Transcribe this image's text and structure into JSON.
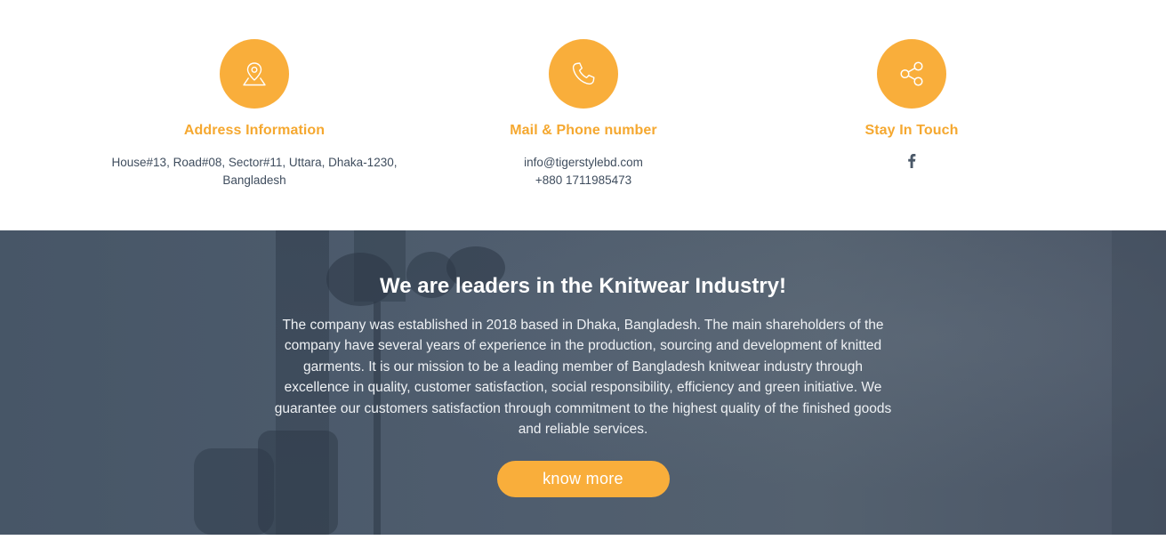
{
  "accent_color": "#f9ae3b",
  "contact": {
    "address": {
      "icon": "map-pin-icon",
      "title": "Address Information",
      "line1": "House#13, Road#08, Sector#11, Uttara, Dhaka-1230,",
      "line2": "Bangladesh"
    },
    "mail_phone": {
      "icon": "phone-icon",
      "title": "Mail & Phone number",
      "email": "info@tigerstylebd.com",
      "phone": "+880 1711985473"
    },
    "social": {
      "icon": "share-icon",
      "title": "Stay In Touch",
      "links": [
        "facebook-icon"
      ]
    }
  },
  "hero": {
    "title": "We are leaders in the Knitwear Industry!",
    "body": "The company was established in 2018 based in Dhaka, Bangladesh. The main shareholders of the company have several years of experience in the production, sourcing and development of knitted garments. It is our mission to be a leading member of Bangladesh knitwear industry through excellence in quality, customer satisfaction, social responsibility, efficiency and green initiative. We guarantee our customers satisfaction through commitment to the highest quality of the finished goods and reliable services.",
    "button_label": "know more"
  }
}
